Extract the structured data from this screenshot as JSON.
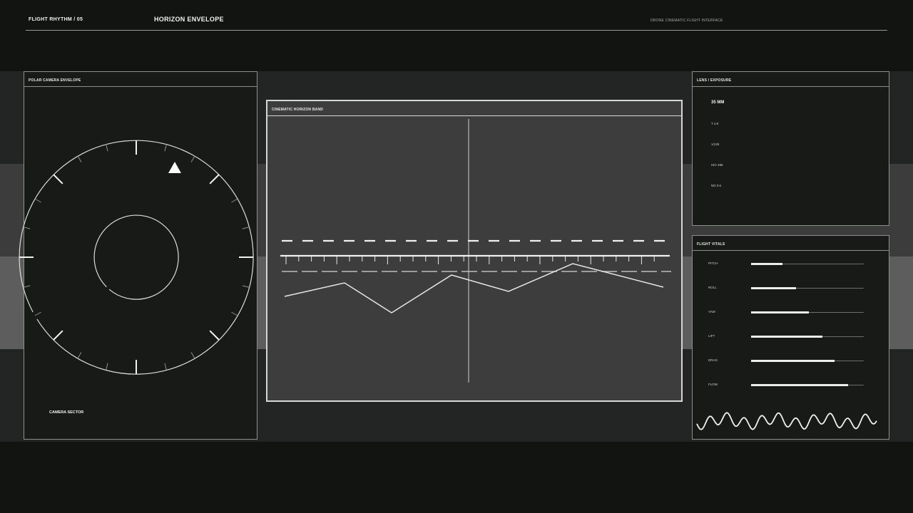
{
  "header": {
    "left": "FLIGHT RHYTHM / 05",
    "title": "HORIZON ENVELOPE",
    "right": "DRONE CINEMATIC FLIGHT INTERFACE"
  },
  "polar_panel": {
    "title": "POLAR CAMERA ENVELOPE",
    "sector_label": "CAMERA SECTOR"
  },
  "horizon_panel": {
    "title": "CINEMATIC HORIZON BAND"
  },
  "lens_panel": {
    "title": "LENS / EXPOSURE",
    "items": [
      "35 MM",
      "T 4.8",
      "1/128",
      "ISO 486",
      "ND 0.6"
    ]
  },
  "vitals_panel": {
    "title": "FLIGHT VITALS",
    "items": [
      {
        "label": "PITCH",
        "value": 0.28
      },
      {
        "label": "ROLL",
        "value": 0.4
      },
      {
        "label": "YAW",
        "value": 0.51
      },
      {
        "label": "LIFT",
        "value": 0.63
      },
      {
        "label": "DRAG",
        "value": 0.74
      },
      {
        "label": "FLOW",
        "value": 0.86
      }
    ]
  },
  "colors": {
    "accent": "#f2f2f2",
    "panel_border": "#8e8e8e",
    "band_dark": "#232524",
    "band_mid": "#3b3c3b",
    "band_light": "#5c5d5c"
  },
  "icons": {
    "heading_marker": "triangle-up-icon",
    "waveform": "waveform-icon"
  }
}
